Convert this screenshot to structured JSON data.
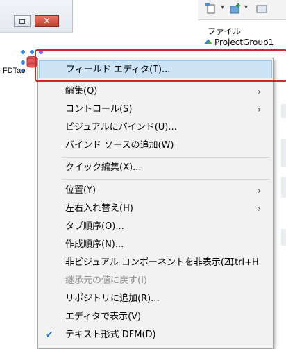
{
  "designer": {
    "component_label": "FDTab",
    "close_glyph": "✕"
  },
  "project_panel": {
    "header": "ファイル",
    "group": "ProjectGroup1"
  },
  "menu": {
    "items": [
      {
        "label": "フィールド エディタ(T)..."
      },
      {
        "label": "編集(Q)",
        "arrow": "›"
      },
      {
        "label": "コントロール(S)",
        "arrow": "›"
      },
      {
        "label": "ビジュアルにバインド(U)..."
      },
      {
        "label": "バインド ソースの追加(W)"
      },
      {
        "label": "クイック編集(X)..."
      },
      {
        "label": "位置(Y)",
        "arrow": "›"
      },
      {
        "label": "左右入れ替え(H)",
        "arrow": "›"
      },
      {
        "label": "タブ順序(O)..."
      },
      {
        "label": "作成順序(N)..."
      },
      {
        "label": "非ビジュアル コンポーネントを非表示(Z)",
        "shortcut": "Ctrl+H"
      },
      {
        "label": "継承元の値に戻す(I)"
      },
      {
        "label": "リポジトリに追加(R)..."
      },
      {
        "label": "エディタで表示(V)"
      },
      {
        "label": "テキスト形式 DFM(D)",
        "check": "✔"
      }
    ]
  },
  "colors": {
    "highlight": "#cce4f7",
    "annotation_frame": "#d0262c",
    "check": "#1e6fd0"
  }
}
